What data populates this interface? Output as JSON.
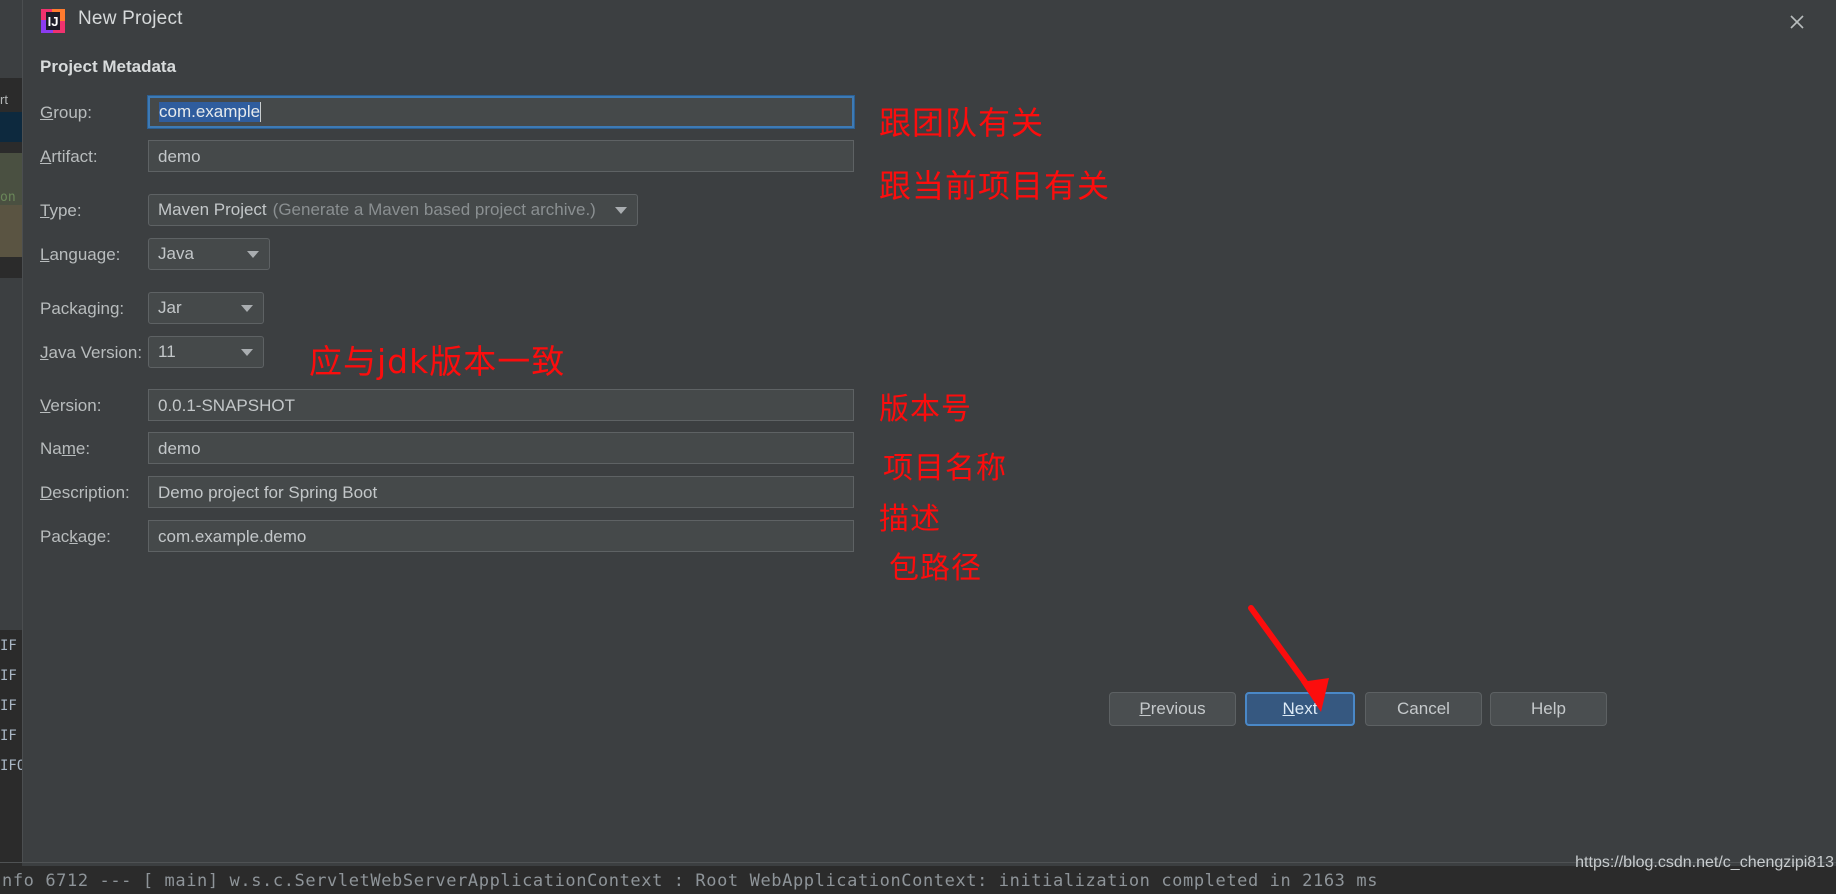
{
  "window": {
    "title": "New Project",
    "icon": "intellij-idea-icon",
    "close_label": "close-icon"
  },
  "section": {
    "heading": "Project Metadata"
  },
  "fields": [
    {
      "name": "group",
      "label_pre": "",
      "label_key": "G",
      "label_post": "roup:",
      "value": "com.example",
      "kind": "text",
      "focused": true,
      "selected": true
    },
    {
      "name": "artifact",
      "label_pre": "",
      "label_key": "A",
      "label_post": "rtifact:",
      "value": "demo",
      "kind": "text",
      "focused": false,
      "selected": false
    },
    {
      "name": "type",
      "label_pre": "",
      "label_key": "T",
      "label_post": "ype:",
      "value": "Maven Project",
      "hint": "(Generate a Maven based project archive.)",
      "kind": "combo",
      "focused": false,
      "selected": false
    },
    {
      "name": "language",
      "label_pre": "",
      "label_key": "L",
      "label_post": "anguage:",
      "value": "Java",
      "kind": "combo",
      "focused": false,
      "selected": false
    },
    {
      "name": "packaging",
      "label_pre": "Packa",
      "label_key": "g",
      "label_post": "ing:",
      "value": "Jar",
      "kind": "combo",
      "focused": false,
      "selected": false
    },
    {
      "name": "java-version",
      "label_pre": "",
      "label_key": "J",
      "label_post": "ava Version:",
      "value": "11",
      "kind": "combo",
      "focused": false,
      "selected": false
    },
    {
      "name": "version",
      "label_pre": "",
      "label_key": "V",
      "label_post": "ersion:",
      "value": "0.0.1-SNAPSHOT",
      "kind": "text",
      "focused": false,
      "selected": false
    },
    {
      "name": "project-name",
      "label_pre": "Na",
      "label_key": "m",
      "label_post": "e:",
      "value": "demo",
      "kind": "text",
      "focused": false,
      "selected": false
    },
    {
      "name": "description",
      "label_pre": "",
      "label_key": "D",
      "label_post": "escription:",
      "value": "Demo project for Spring Boot",
      "kind": "text",
      "focused": false,
      "selected": false
    },
    {
      "name": "package",
      "label_pre": "Pac",
      "label_key": "k",
      "label_post": "age:",
      "value": "com.example.demo",
      "kind": "text",
      "focused": false,
      "selected": false
    }
  ],
  "annotations": [
    {
      "name": "group-note",
      "text": "跟团队有关"
    },
    {
      "name": "artifact-note",
      "text": "跟当前项目有关"
    },
    {
      "name": "java-version-note",
      "text": "应与jdk版本一致"
    },
    {
      "name": "version-note",
      "text": "版本号"
    },
    {
      "name": "name-note",
      "text": "项目名称"
    },
    {
      "name": "description-note",
      "text": "描述"
    },
    {
      "name": "package-note",
      "text": "包路径"
    }
  ],
  "buttons": {
    "previous": {
      "pre": "",
      "key": "P",
      "post": "revious"
    },
    "next": {
      "pre": "",
      "key": "N",
      "post": "ext"
    },
    "cancel": {
      "pre": "Cancel",
      "key": "",
      "post": ""
    },
    "help": {
      "pre": "Help",
      "key": "",
      "post": ""
    }
  },
  "watermark": "https://blog.csdn.net/c_chengzipi813",
  "background": {
    "tab_label": "rt",
    "green_text": "on",
    "console_lines": [
      "IF",
      "IF",
      "IF",
      "IF",
      "IFO"
    ],
    "console_bottom": "nfo 6712  --- [           main] w.s.c.ServletWebServerApplicationContext : Root WebApplicationContext: initialization completed in 2163 ms"
  },
  "colors": {
    "dialog_bg": "#3c3f41",
    "input_bg": "#45494a",
    "accent_blue": "#365880",
    "focus_border": "#3d7ab5",
    "annotation_red": "#fc0d0d",
    "selection_blue": "#2f5d9e"
  }
}
